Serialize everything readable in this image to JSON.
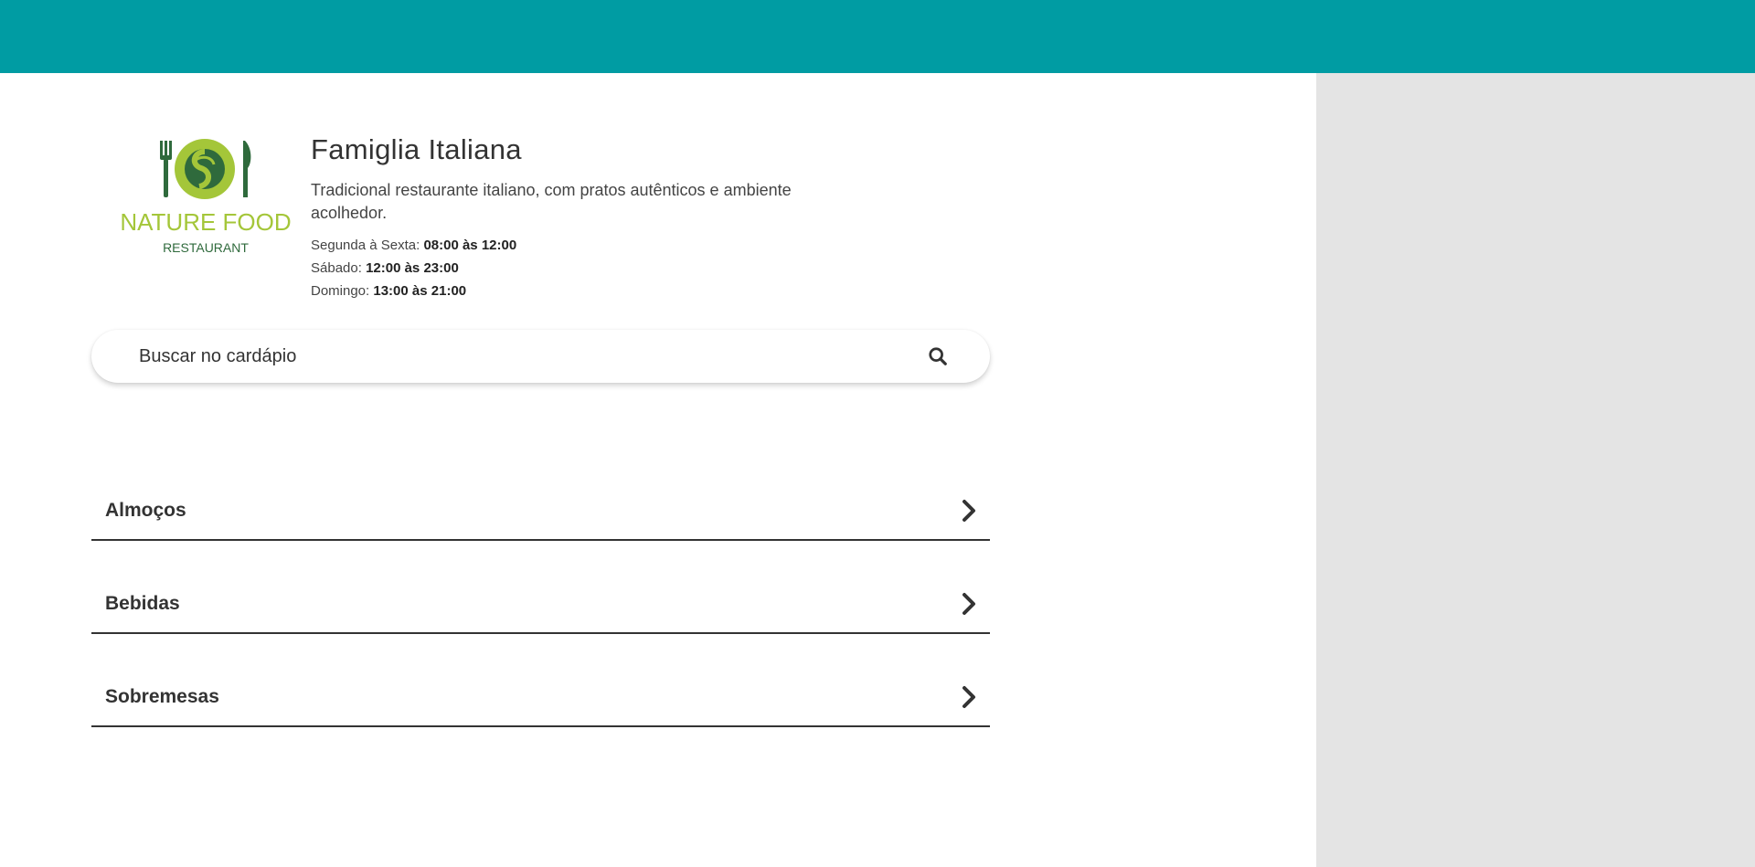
{
  "colors": {
    "topbar": "#009ca3",
    "sidepanel": "#e4e4e4",
    "logo_dark_green": "#2f6a3c",
    "logo_light_green": "#a4c639"
  },
  "logo": {
    "line1": "NATURE FOOD",
    "line2": "RESTAURANT"
  },
  "restaurant": {
    "name": "Famiglia Italiana",
    "description": "Tradicional restaurante italiano, com pratos autênticos e ambiente acolhedor.",
    "hours": [
      {
        "label": "Segunda à Sexta:",
        "value": "08:00 às 12:00"
      },
      {
        "label": "Sábado:",
        "value": "12:00 às 23:00"
      },
      {
        "label": "Domingo:",
        "value": "13:00 às 21:00"
      }
    ]
  },
  "search": {
    "placeholder": "Buscar no cardápio",
    "icon": "search-icon"
  },
  "categories": [
    {
      "label": "Almoços",
      "icon": "chevron-right-icon"
    },
    {
      "label": "Bebidas",
      "icon": "chevron-right-icon"
    },
    {
      "label": "Sobremesas",
      "icon": "chevron-right-icon"
    }
  ]
}
